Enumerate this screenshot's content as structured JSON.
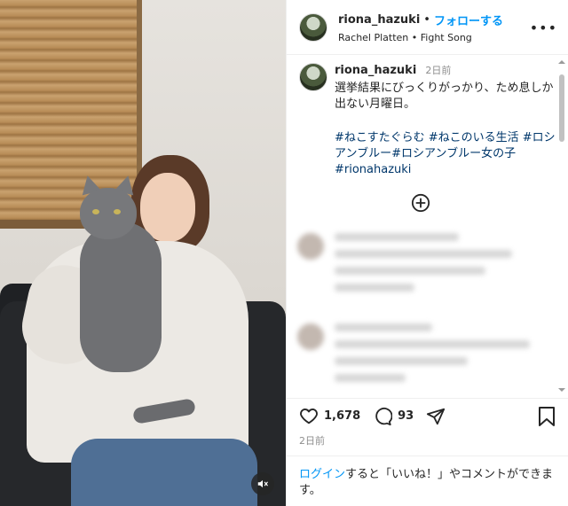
{
  "post": {
    "username": "riona_hazuki",
    "follow_label": "フォローする",
    "separator": "•",
    "audio": "Rachel Platten • Fight Song",
    "more_label": "•••"
  },
  "caption": {
    "username": "riona_hazuki",
    "time": "2日前",
    "text": "選挙結果にびっくりがっかり、ため息しか出ない月曜日。",
    "hashtags": "#ねこすたぐらむ #ねこのいる生活 #ロシアンブルー#ロシアンブルー女の子 #rionahazuki"
  },
  "stats": {
    "likes": "1,678",
    "comments": "93",
    "date": "2日前"
  },
  "login_prompt": {
    "link": "ログイン",
    "text": "すると「いいね！」やコメントができます。"
  },
  "icons": {
    "load_more": "plus-circle-icon",
    "like": "heart-icon",
    "comment": "comment-icon",
    "share": "send-icon",
    "save": "bookmark-icon",
    "mute": "speaker-muted-icon"
  },
  "colors": {
    "accent": "#0095f6",
    "hashtag": "#00376b",
    "muted": "#8e8e8e"
  }
}
